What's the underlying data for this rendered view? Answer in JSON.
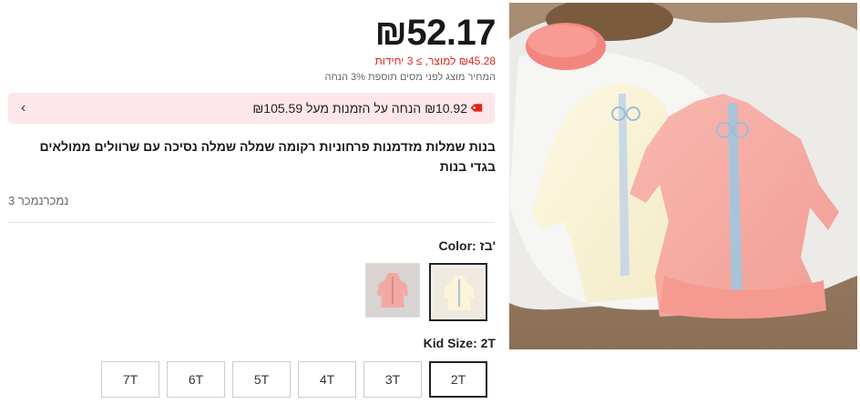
{
  "price": {
    "main": "₪52.17",
    "unit_note": "₪45.28 למוצר, ≥ 3 יחידות",
    "tax_note": "המחיר מוצג לפני מסים תוספת 3% הנחה"
  },
  "promo": {
    "text": "₪10.92 הנחה על הזמנות מעל ₪105.59",
    "chevron": "‹",
    "icon": "tag-icon"
  },
  "product": {
    "title": "בנות שמלות מזדמנות פרחוניות רקומה שמלה שמלה נסיכה עם שרוולים ממולאים בגדי בנות"
  },
  "sold": "נמכרנמכר 3",
  "color": {
    "label": "Color: בז'",
    "options": [
      "pink-dress-swatch",
      "beige-dress-swatch"
    ],
    "selected": "בז'"
  },
  "size": {
    "label": "Kid Size: 2T",
    "options": [
      "7T",
      "6T",
      "5T",
      "4T",
      "3T",
      "2T"
    ],
    "selected": "2T"
  },
  "colors": {
    "accent_red": "#e1251b",
    "promo_bg": "#fde7ea"
  }
}
